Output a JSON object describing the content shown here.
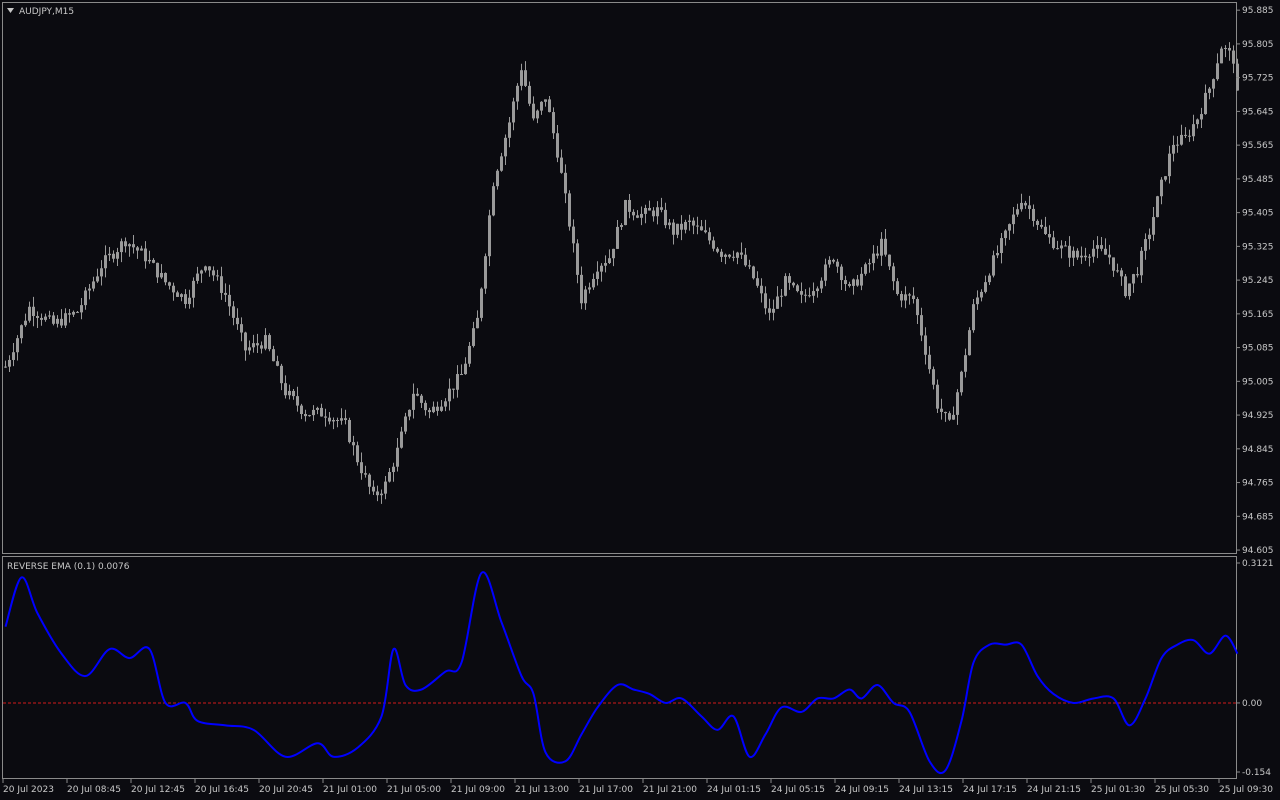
{
  "symbol_title": "AUDJPY,M15",
  "indicator_title": "REVERSE EMA (0.1) 0.0076",
  "colors": {
    "background": "#0b0b10",
    "frame": "#8a8a8a",
    "candle": "#9a9a9a",
    "indicator_line": "#0000ff",
    "zero_line": "#d11a1a",
    "text": "#c8c8c8"
  },
  "chart_data": [
    {
      "type": "candlestick",
      "title": "AUDJPY,M15",
      "price_axis_ticks": [
        "95.885",
        "95.805",
        "95.725",
        "95.645",
        "95.565",
        "95.485",
        "95.405",
        "95.325",
        "95.245",
        "95.165",
        "95.085",
        "95.005",
        "94.925",
        "94.845",
        "94.765",
        "94.685",
        "94.605"
      ],
      "ylim": [
        94.598,
        95.902
      ],
      "grid": false,
      "time_axis_ticks": [
        "20 Jul 2023",
        "20 Jul 08:45",
        "20 Jul 12:45",
        "20 Jul 16:45",
        "20 Jul 20:45",
        "21 Jul 01:00",
        "21 Jul 05:00",
        "21 Jul 09:00",
        "21 Jul 13:00",
        "21 Jul 17:00",
        "21 Jul 21:00",
        "24 Jul 01:15",
        "24 Jul 05:15",
        "24 Jul 09:15",
        "24 Jul 13:15",
        "24 Jul 17:15",
        "24 Jul 21:15",
        "25 Jul 01:30",
        "25 Jul 05:30",
        "25 Jul 09:30"
      ],
      "close_anchors": [
        [
          0,
          95.04
        ],
        [
          6,
          95.18
        ],
        [
          12,
          95.14
        ],
        [
          18,
          95.17
        ],
        [
          24,
          95.28
        ],
        [
          30,
          95.34
        ],
        [
          35,
          95.3
        ],
        [
          40,
          95.24
        ],
        [
          45,
          95.2
        ],
        [
          50,
          95.29
        ],
        [
          55,
          95.21
        ],
        [
          60,
          95.08
        ],
        [
          65,
          95.1
        ],
        [
          70,
          94.98
        ],
        [
          75,
          94.93
        ],
        [
          80,
          94.93
        ],
        [
          85,
          94.9
        ],
        [
          88,
          94.82
        ],
        [
          92,
          94.73
        ],
        [
          95,
          94.76
        ],
        [
          98,
          94.84
        ],
        [
          102,
          94.98
        ],
        [
          106,
          94.93
        ],
        [
          110,
          94.97
        ],
        [
          114,
          95.02
        ],
        [
          118,
          95.15
        ],
        [
          122,
          95.48
        ],
        [
          126,
          95.62
        ],
        [
          129,
          95.75
        ],
        [
          132,
          95.62
        ],
        [
          135,
          95.68
        ],
        [
          138,
          95.55
        ],
        [
          141,
          95.38
        ],
        [
          144,
          95.2
        ],
        [
          148,
          95.28
        ],
        [
          151,
          95.3
        ],
        [
          155,
          95.42
        ],
        [
          159,
          95.4
        ],
        [
          163,
          95.41
        ],
        [
          167,
          95.36
        ],
        [
          171,
          95.38
        ],
        [
          175,
          95.35
        ],
        [
          179,
          95.31
        ],
        [
          183,
          95.31
        ],
        [
          187,
          95.25
        ],
        [
          191,
          95.16
        ],
        [
          195,
          95.24
        ],
        [
          199,
          95.2
        ],
        [
          203,
          95.24
        ],
        [
          207,
          95.3
        ],
        [
          211,
          95.22
        ],
        [
          215,
          95.27
        ],
        [
          219,
          95.33
        ],
        [
          223,
          95.21
        ],
        [
          227,
          95.2
        ],
        [
          230,
          95.08
        ],
        [
          233,
          94.95
        ],
        [
          236,
          94.9
        ],
        [
          239,
          95.02
        ],
        [
          242,
          95.18
        ],
        [
          246,
          95.27
        ],
        [
          250,
          95.35
        ],
        [
          254,
          95.44
        ],
        [
          257,
          95.4
        ],
        [
          260,
          95.35
        ],
        [
          264,
          95.32
        ],
        [
          268,
          95.3
        ],
        [
          272,
          95.32
        ],
        [
          276,
          95.3
        ],
        [
          280,
          95.22
        ],
        [
          283,
          95.27
        ],
        [
          286,
          95.36
        ],
        [
          289,
          95.47
        ],
        [
          292,
          95.57
        ],
        [
          295,
          95.58
        ],
        [
          298,
          95.63
        ],
        [
          301,
          95.7
        ],
        [
          304,
          95.8
        ],
        [
          307,
          95.77
        ],
        [
          308,
          95.68
        ]
      ]
    },
    {
      "type": "line",
      "title": "REVERSE EMA (0.1) 0.0076",
      "ylim": [
        -0.154,
        0.3121
      ],
      "axis_ticks": [
        "0.3121",
        "0.00",
        "-0.154"
      ],
      "reference_line": 0.0,
      "series": [
        {
          "values": [
            [
              0,
              0.17
            ],
            [
              4,
              0.28
            ],
            [
              8,
              0.2
            ],
            [
              14,
              0.11
            ],
            [
              20,
              0.06
            ],
            [
              26,
              0.12
            ],
            [
              31,
              0.1
            ],
            [
              36,
              0.12
            ],
            [
              40,
              0.0
            ],
            [
              45,
              0.0
            ],
            [
              48,
              -0.04
            ],
            [
              55,
              -0.05
            ],
            [
              62,
              -0.06
            ],
            [
              70,
              -0.12
            ],
            [
              78,
              -0.09
            ],
            [
              82,
              -0.12
            ],
            [
              88,
              -0.1
            ],
            [
              94,
              -0.03
            ],
            [
              97,
              0.12
            ],
            [
              100,
              0.04
            ],
            [
              104,
              0.03
            ],
            [
              110,
              0.07
            ],
            [
              114,
              0.09
            ],
            [
              119,
              0.29
            ],
            [
              124,
              0.18
            ],
            [
              129,
              0.06
            ],
            [
              132,
              0.02
            ],
            [
              135,
              -0.11
            ],
            [
              140,
              -0.13
            ],
            [
              144,
              -0.07
            ],
            [
              148,
              -0.01
            ],
            [
              153,
              0.04
            ],
            [
              157,
              0.03
            ],
            [
              161,
              0.02
            ],
            [
              165,
              0.0
            ],
            [
              169,
              0.01
            ],
            [
              174,
              -0.03
            ],
            [
              178,
              -0.06
            ],
            [
              182,
              -0.03
            ],
            [
              186,
              -0.12
            ],
            [
              190,
              -0.07
            ],
            [
              194,
              -0.01
            ],
            [
              199,
              -0.02
            ],
            [
              203,
              0.01
            ],
            [
              207,
              0.01
            ],
            [
              211,
              0.03
            ],
            [
              214,
              0.01
            ],
            [
              218,
              0.04
            ],
            [
              222,
              0.0
            ],
            [
              226,
              -0.02
            ],
            [
              231,
              -0.13
            ],
            [
              235,
              -0.15
            ],
            [
              239,
              -0.04
            ],
            [
              242,
              0.09
            ],
            [
              246,
              0.13
            ],
            [
              250,
              0.13
            ],
            [
              254,
              0.13
            ],
            [
              258,
              0.06
            ],
            [
              262,
              0.02
            ],
            [
              267,
              0.0
            ],
            [
              272,
              0.01
            ],
            [
              277,
              0.01
            ],
            [
              281,
              -0.05
            ],
            [
              285,
              0.01
            ],
            [
              289,
              0.1
            ],
            [
              293,
              0.13
            ],
            [
              297,
              0.14
            ],
            [
              301,
              0.11
            ],
            [
              305,
              0.15
            ],
            [
              308,
              0.11
            ]
          ]
        }
      ]
    }
  ]
}
